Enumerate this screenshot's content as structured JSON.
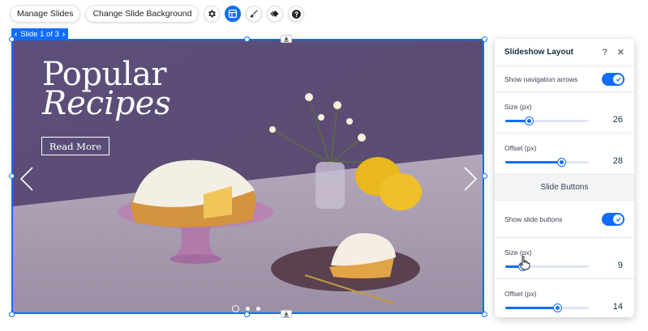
{
  "toolbar": {
    "manage_slides": "Manage Slides",
    "change_background": "Change Slide Background",
    "icons": [
      "gear-icon",
      "layout-icon",
      "design-brush-icon",
      "animation-icon",
      "help-icon"
    ]
  },
  "slide_tab": {
    "label": "Slide 1 of 3",
    "prev": "‹",
    "next": "›"
  },
  "slide": {
    "title_line1": "Popular",
    "title_line2": "Recipes",
    "button_label": "Read More",
    "dots_count": 3,
    "active_dot": 0
  },
  "panel": {
    "title": "Slideshow Layout",
    "help": "?",
    "close": "✕",
    "nav_arrows_label": "Show navigation arrows",
    "nav_arrows_on": true,
    "arrow_size_label": "Size (px)",
    "arrow_size_value": "26",
    "arrow_size_fraction": 0.28,
    "arrow_offset_label": "Offset (px)",
    "arrow_offset_value": "28",
    "arrow_offset_fraction": 0.67,
    "slide_buttons_header": "Slide Buttons",
    "slide_buttons_label": "Show slide buttons",
    "slide_buttons_on": true,
    "button_size_label": "Size (px)",
    "button_size_value": "9",
    "button_size_fraction": 0.2,
    "button_offset_label": "Offset (px)",
    "button_offset_value": "14",
    "button_offset_fraction": 0.62
  },
  "colors": {
    "accent": "#116dff",
    "slide_wall": "#5e4f78",
    "slide_table": "#a497ad"
  }
}
